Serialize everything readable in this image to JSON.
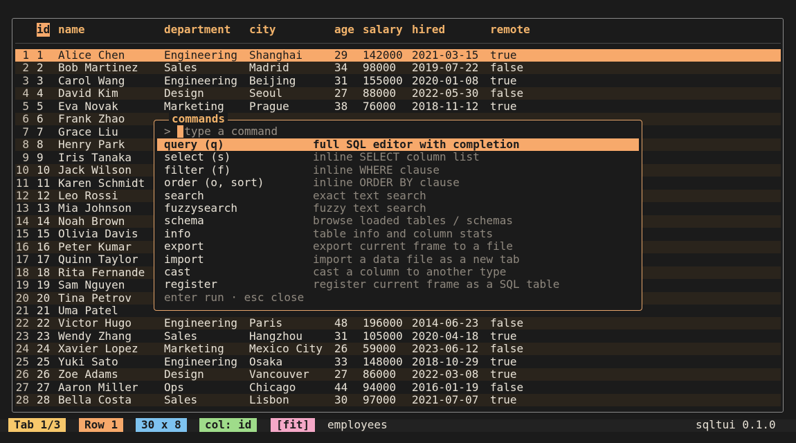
{
  "table": {
    "columns": [
      {
        "key": "id",
        "label": "id"
      },
      {
        "key": "name",
        "label": "name"
      },
      {
        "key": "department",
        "label": "department"
      },
      {
        "key": "city",
        "label": "city"
      },
      {
        "key": "age",
        "label": "age"
      },
      {
        "key": "salary",
        "label": "salary"
      },
      {
        "key": "hired",
        "label": "hired"
      },
      {
        "key": "remote",
        "label": "remote"
      }
    ],
    "rows": [
      {
        "n": "1",
        "id": "1",
        "name": "Alice Chen",
        "department": "Engineering",
        "city": "Shanghai",
        "age": "29",
        "salary": "142000",
        "hired": "2021-03-15",
        "remote": "true"
      },
      {
        "n": "2",
        "id": "2",
        "name": "Bob Martinez",
        "department": "Sales",
        "city": "Madrid",
        "age": "34",
        "salary": "98000",
        "hired": "2019-07-22",
        "remote": "false"
      },
      {
        "n": "3",
        "id": "3",
        "name": "Carol Wang",
        "department": "Engineering",
        "city": "Beijing",
        "age": "31",
        "salary": "155000",
        "hired": "2020-01-08",
        "remote": "true"
      },
      {
        "n": "4",
        "id": "4",
        "name": "David Kim",
        "department": "Design",
        "city": "Seoul",
        "age": "27",
        "salary": "88000",
        "hired": "2022-05-30",
        "remote": "false"
      },
      {
        "n": "5",
        "id": "5",
        "name": "Eva Novak",
        "department": "Marketing",
        "city": "Prague",
        "age": "38",
        "salary": "76000",
        "hired": "2018-11-12",
        "remote": "true"
      },
      {
        "n": "6",
        "id": "6",
        "name": "Frank Zhao",
        "department": "",
        "city": "",
        "age": "",
        "salary": "",
        "hired": "",
        "remote": ""
      },
      {
        "n": "7",
        "id": "7",
        "name": "Grace Liu",
        "department": "",
        "city": "",
        "age": "",
        "salary": "",
        "hired": "",
        "remote": ""
      },
      {
        "n": "8",
        "id": "8",
        "name": "Henry Park",
        "department": "",
        "city": "",
        "age": "",
        "salary": "",
        "hired": "",
        "remote": ""
      },
      {
        "n": "9",
        "id": "9",
        "name": "Iris Tanaka",
        "department": "",
        "city": "",
        "age": "",
        "salary": "",
        "hired": "",
        "remote": ""
      },
      {
        "n": "10",
        "id": "10",
        "name": "Jack Wilson",
        "department": "",
        "city": "",
        "age": "",
        "salary": "",
        "hired": "",
        "remote": ""
      },
      {
        "n": "11",
        "id": "11",
        "name": "Karen Schmidt",
        "department": "",
        "city": "",
        "age": "",
        "salary": "",
        "hired": "",
        "remote": ""
      },
      {
        "n": "12",
        "id": "12",
        "name": "Leo Rossi",
        "department": "",
        "city": "",
        "age": "",
        "salary": "",
        "hired": "",
        "remote": ""
      },
      {
        "n": "13",
        "id": "13",
        "name": "Mia Johnson",
        "department": "",
        "city": "",
        "age": "",
        "salary": "",
        "hired": "",
        "remote": ""
      },
      {
        "n": "14",
        "id": "14",
        "name": "Noah Brown",
        "department": "",
        "city": "",
        "age": "",
        "salary": "",
        "hired": "",
        "remote": ""
      },
      {
        "n": "15",
        "id": "15",
        "name": "Olivia Davis",
        "department": "",
        "city": "",
        "age": "",
        "salary": "",
        "hired": "",
        "remote": ""
      },
      {
        "n": "16",
        "id": "16",
        "name": "Peter Kumar",
        "department": "",
        "city": "",
        "age": "",
        "salary": "",
        "hired": "",
        "remote": ""
      },
      {
        "n": "17",
        "id": "17",
        "name": "Quinn Taylor",
        "department": "",
        "city": "",
        "age": "",
        "salary": "",
        "hired": "",
        "remote": ""
      },
      {
        "n": "18",
        "id": "18",
        "name": "Rita Fernande",
        "department": "",
        "city": "",
        "age": "",
        "salary": "",
        "hired": "",
        "remote": ""
      },
      {
        "n": "19",
        "id": "19",
        "name": "Sam Nguyen",
        "department": "",
        "city": "",
        "age": "",
        "salary": "",
        "hired": "",
        "remote": ""
      },
      {
        "n": "20",
        "id": "20",
        "name": "Tina Petrov",
        "department": "",
        "city": "",
        "age": "",
        "salary": "",
        "hired": "",
        "remote": ""
      },
      {
        "n": "21",
        "id": "21",
        "name": "Uma Patel",
        "department": "",
        "city": "",
        "age": "",
        "salary": "",
        "hired": "",
        "remote": ""
      },
      {
        "n": "22",
        "id": "22",
        "name": "Victor Hugo",
        "department": "Engineering",
        "city": "Paris",
        "age": "48",
        "salary": "196000",
        "hired": "2014-06-23",
        "remote": "false"
      },
      {
        "n": "23",
        "id": "23",
        "name": "Wendy Zhang",
        "department": "Sales",
        "city": "Hangzhou",
        "age": "31",
        "salary": "105000",
        "hired": "2020-04-18",
        "remote": "true"
      },
      {
        "n": "24",
        "id": "24",
        "name": "Xavier Lopez",
        "department": "Marketing",
        "city": "Mexico City",
        "age": "26",
        "salary": "59000",
        "hired": "2023-06-12",
        "remote": "false"
      },
      {
        "n": "25",
        "id": "25",
        "name": "Yuki Sato",
        "department": "Engineering",
        "city": "Osaka",
        "age": "33",
        "salary": "148000",
        "hired": "2018-10-29",
        "remote": "true"
      },
      {
        "n": "26",
        "id": "26",
        "name": "Zoe Adams",
        "department": "Design",
        "city": "Vancouver",
        "age": "27",
        "salary": "86000",
        "hired": "2022-03-08",
        "remote": "true"
      },
      {
        "n": "27",
        "id": "27",
        "name": "Aaron Miller",
        "department": "Ops",
        "city": "Chicago",
        "age": "44",
        "salary": "94000",
        "hired": "2016-01-19",
        "remote": "false"
      },
      {
        "n": "28",
        "id": "28",
        "name": "Bella Costa",
        "department": "Sales",
        "city": "Lisbon",
        "age": "30",
        "salary": "97000",
        "hired": "2021-07-07",
        "remote": "true"
      }
    ],
    "selected_row_index": 0,
    "selected_column": "id"
  },
  "palette": {
    "title": "commands",
    "prompt_symbol": ">",
    "placeholder": "type a command",
    "commands": [
      {
        "name": "query (q)",
        "desc": "full SQL editor with completion",
        "selected": true
      },
      {
        "name": "select (s)",
        "desc": "inline SELECT column list"
      },
      {
        "name": "filter (f)",
        "desc": "inline WHERE clause"
      },
      {
        "name": "order (o, sort)",
        "desc": "inline ORDER BY clause"
      },
      {
        "name": "search",
        "desc": "exact text search"
      },
      {
        "name": "fuzzysearch",
        "desc": "fuzzy text search"
      },
      {
        "name": "schema",
        "desc": "browse loaded tables / schemas"
      },
      {
        "name": "info",
        "desc": "table info and column stats"
      },
      {
        "name": "export",
        "desc": "export current frame to a file"
      },
      {
        "name": "import",
        "desc": "import a data file as a new tab"
      },
      {
        "name": "cast",
        "desc": "cast a column to another type"
      },
      {
        "name": "register",
        "desc": "register current frame as a SQL table"
      }
    ],
    "hint": "enter run · esc close"
  },
  "status": {
    "pills": [
      {
        "label": "Tab 1/3",
        "color": "#f7c86b"
      },
      {
        "label": "Row 1",
        "color": "#f7a96b"
      },
      {
        "label": "30 x 8",
        "color": "#7ec3f0"
      },
      {
        "label": "col: id",
        "color": "#9fdc8a"
      },
      {
        "label": "[fit]",
        "color": "#f5a8c8"
      }
    ],
    "table_name": "employees",
    "version": "sqltui 0.1.0"
  }
}
